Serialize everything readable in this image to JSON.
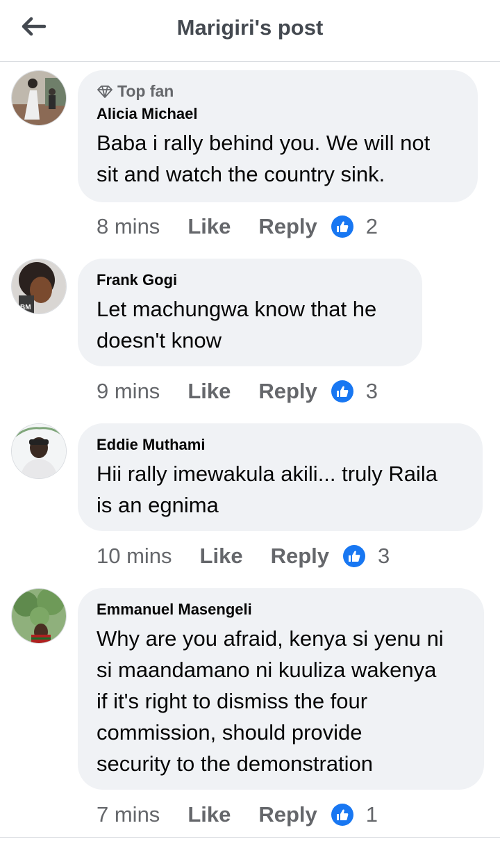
{
  "header": {
    "title": "Marigiri's post"
  },
  "comments": [
    {
      "badge": "Top fan",
      "author": "Alicia Michael",
      "text": "Baba i rally behind you.  We will not\nsit and watch the country sink.",
      "time": "8 mins",
      "like_label": "Like",
      "reply_label": "Reply",
      "reaction_count": "2"
    },
    {
      "author": "Frank Gogi",
      "text": "Let machungwa know that he\ndoesn't know",
      "time": "9 mins",
      "like_label": "Like",
      "reply_label": "Reply",
      "reaction_count": "3"
    },
    {
      "author": "Eddie Muthami",
      "text": "Hii rally imewakula akili... truly Raila\nis an egnima",
      "time": "10 mins",
      "like_label": "Like",
      "reply_label": "Reply",
      "reaction_count": "3"
    },
    {
      "author": "Emmanuel Masengeli",
      "text": "Why are you afraid, kenya si yenu ni\nsi maandamano ni kuuliza wakenya\nif it's right to dismiss the four\ncommission, should provide\nsecurity to the demonstration",
      "time": "7 mins",
      "like_label": "Like",
      "reply_label": "Reply",
      "reaction_count": "1"
    }
  ],
  "colors": {
    "bubble": "#f0f2f5",
    "secondary_text": "#65676b",
    "like_blue": "#1877f2"
  },
  "icons": [
    "back-arrow-icon",
    "diamond-icon",
    "like-reaction-icon"
  ]
}
